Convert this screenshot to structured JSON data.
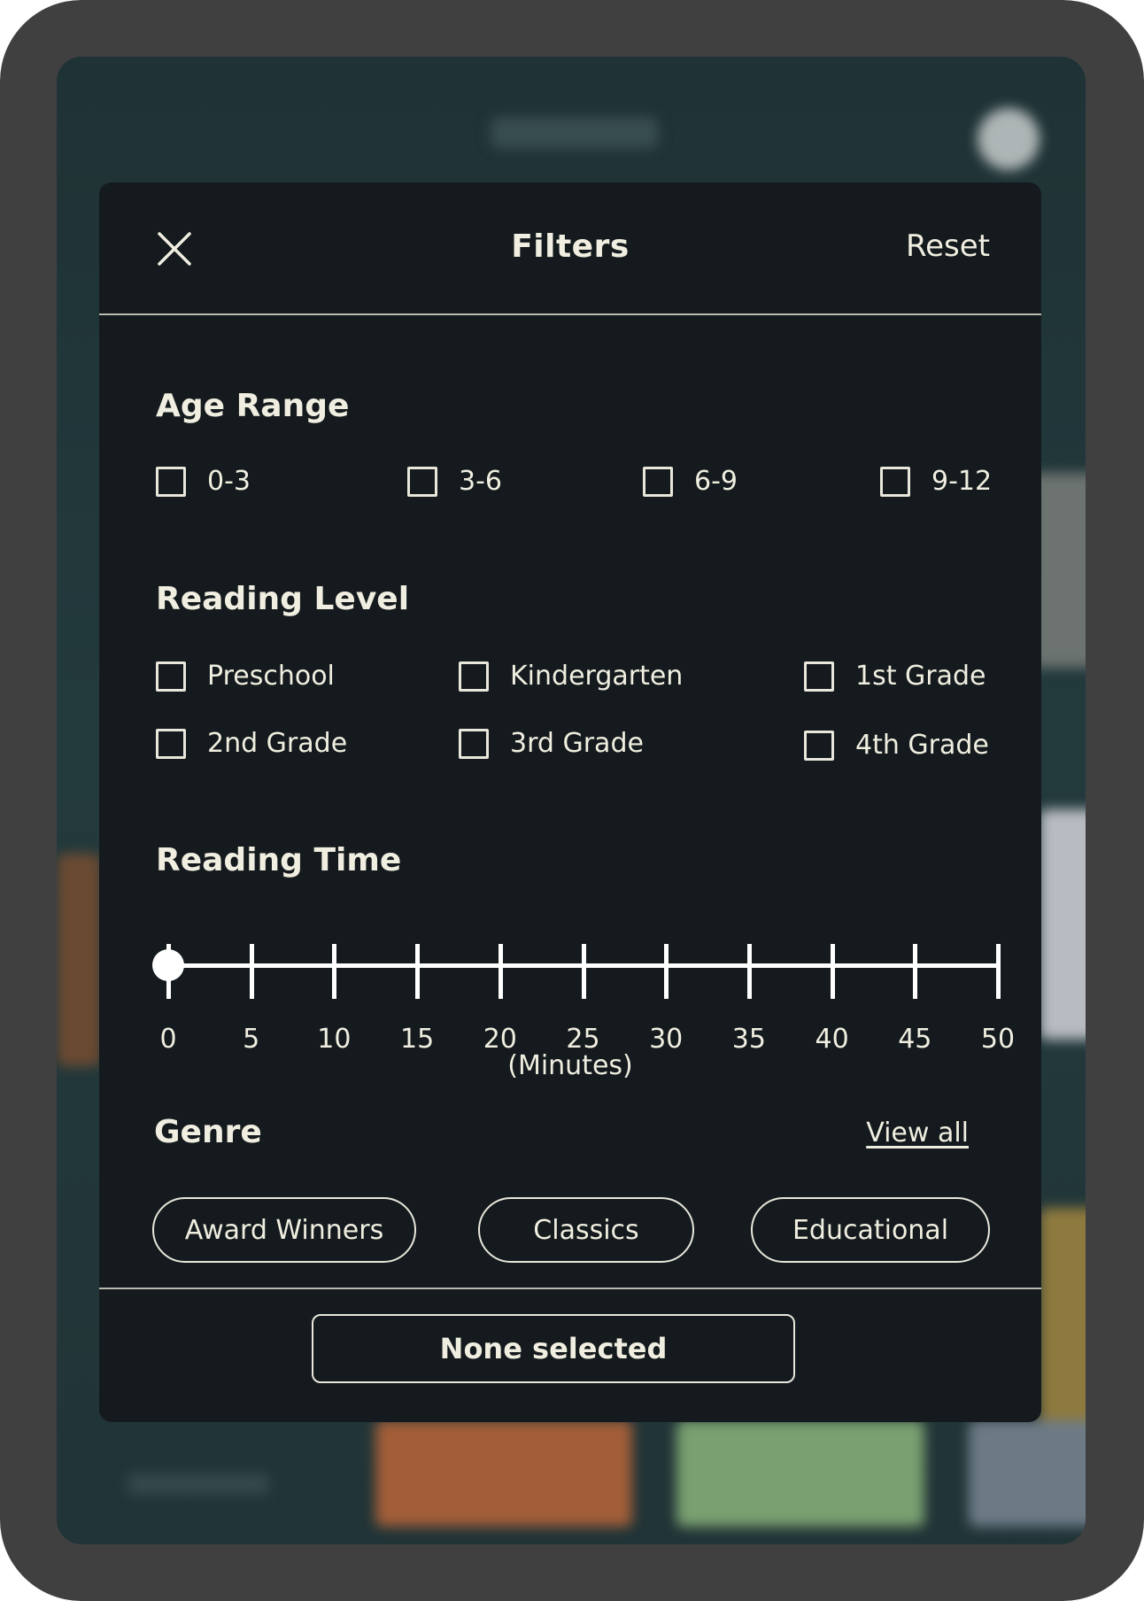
{
  "header": {
    "title": "Filters",
    "reset_label": "Reset",
    "close_icon": "close-icon"
  },
  "age_range": {
    "title": "Age Range",
    "options": [
      {
        "label": "0-3",
        "checked": false
      },
      {
        "label": "3-6",
        "checked": false
      },
      {
        "label": "6-9",
        "checked": false
      },
      {
        "label": "9-12",
        "checked": false
      }
    ]
  },
  "reading_level": {
    "title": "Reading Level",
    "options": [
      {
        "label": "Preschool",
        "checked": false
      },
      {
        "label": "Kindergarten",
        "checked": false
      },
      {
        "label": "1st Grade",
        "checked": false
      },
      {
        "label": "2nd Grade",
        "checked": false
      },
      {
        "label": "3rd Grade",
        "checked": false
      },
      {
        "label": "4th Grade",
        "checked": false
      }
    ]
  },
  "reading_time": {
    "title": "Reading Time",
    "ticks": [
      "0",
      "5",
      "10",
      "15",
      "20",
      "25",
      "30",
      "35",
      "40",
      "45",
      "50"
    ],
    "min": 0,
    "max": 50,
    "value": 0,
    "unit_label": "(Minutes)"
  },
  "genre": {
    "title": "Genre",
    "view_all_label": "View all",
    "pills": [
      "Award Winners",
      "Classics",
      "Educational"
    ]
  },
  "footer": {
    "apply_label": "None selected"
  },
  "colors": {
    "modal_bg": "#141a1d",
    "text": "#f0eee0",
    "backdrop": "#233a3d",
    "device_frame": "#404040"
  }
}
